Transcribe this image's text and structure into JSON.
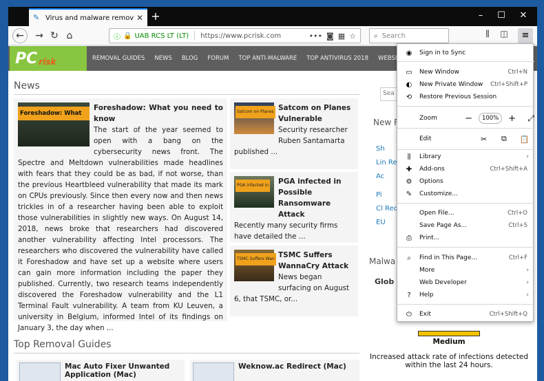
{
  "browser": {
    "tab_title": "Virus and malware removal inst",
    "url_org": "UAB RCS LT (LT)",
    "url": "https://www.pcrisk.com",
    "search_placeholder": "Search"
  },
  "site": {
    "logo_pc": "PC",
    "logo_risk": "risk",
    "menu": [
      "REMOVAL GUIDES",
      "NEWS",
      "BLOG",
      "FORUM",
      "TOP ANTI-MALWARE",
      "TOP ANTIVIRUS 2018",
      "WEBSITE S"
    ],
    "news_heading": "News",
    "main_article": {
      "img_caption": "Foreshadow: What",
      "title": "Foreshadow: What you need to know",
      "body": "The start of the year seemed to open with a bang on the cybersecurity news front. The Spectre and Meltdown vulnerabilities made headlines with fears that they could be as bad, if not worse, than the previous Heartbleed vulnerability that made its mark on CPUs previously. Since then every now and then news trickles in of a researcher having been able to exploit those vulnerabilities in slightly new ways. On August 14, 2018, news broke that researchers had discovered another vulnerability affecting Intel processors. The researchers who discovered the vulnerability have called it Foreshadow and have set up a website where users can gain more information including the paper they published. Currently, two research teams independently discovered the Foreshadow vulnerability and the L1 Terminal Fault vulnerability. A team from KU Leuven, a university in Belgium, informed Intel of its findings on January 3, the day when ..."
    },
    "side_articles": [
      {
        "img_caption": "Satcom on Planes",
        "title": "Satcom on Planes Vulnerable",
        "body": "Security researcher Ruben Santamarta published ..."
      },
      {
        "img_caption": "PGA infected in",
        "title": "PGA infected in Possible Ransomware Attack",
        "body": "Recently many security firms have detailed the ..."
      },
      {
        "img_caption": "TSMC Suffers Wan",
        "title": "TSMC Suffers WannaCry Attack",
        "body": "News began surfacing on August 6, that TSMC, or..."
      }
    ],
    "guides_heading": "Top Removal Guides",
    "guides": [
      {
        "title": "Mac Auto Fixer Unwanted Application (Mac)"
      },
      {
        "title": "Weknow.ac Redirect (Mac)"
      }
    ],
    "right": {
      "search_stub": "Sea",
      "new_heading": "New F",
      "items": [
        "Sh",
        "Lin Redi",
        "Ac",
        "Pi",
        "Cl Redi",
        "EU"
      ],
      "malware_heading": "Malwa",
      "glob": "Glob",
      "threat_level": "Medium",
      "threat_text": "Increased attack rate of infections detected within the last 24 hours."
    }
  },
  "menu": {
    "sign_in": "Sign in to Sync",
    "new_window": "New Window",
    "new_window_sc": "Ctrl+N",
    "new_private": "New Private Window",
    "new_private_sc": "Ctrl+Shift+P",
    "restore": "Restore Previous Session",
    "zoom": "Zoom",
    "zoom_value": "100%",
    "edit": "Edit",
    "library": "Library",
    "addons": "Add-ons",
    "addons_sc": "Ctrl+Shift+A",
    "options": "Options",
    "customize": "Customize...",
    "open_file": "Open File...",
    "open_file_sc": "Ctrl+O",
    "save_page": "Save Page As...",
    "save_page_sc": "Ctrl+S",
    "print": "Print...",
    "find": "Find in This Page...",
    "find_sc": "Ctrl+F",
    "more": "More",
    "webdev": "Web Developer",
    "help": "Help",
    "exit": "Exit",
    "exit_sc": "Ctrl+Shift+Q"
  }
}
